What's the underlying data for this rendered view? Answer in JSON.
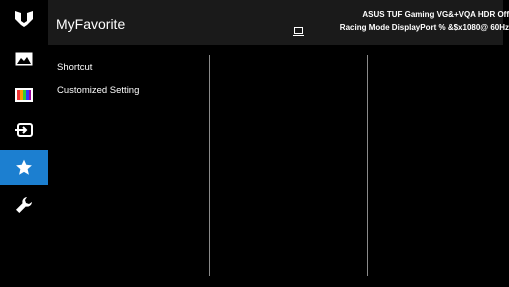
{
  "sidebar": {
    "icons": [
      {
        "name": "tuf-logo-icon"
      },
      {
        "name": "image-icon"
      },
      {
        "name": "color-icon"
      },
      {
        "name": "input-select-icon"
      },
      {
        "name": "star-icon"
      },
      {
        "name": "wrench-icon"
      }
    ],
    "active_index": 4,
    "active_color": "#1c7fd0"
  },
  "header": {
    "title": "MyFavorite",
    "status_line1": "ASUS TUF Gaming  VG&+VQA  HDR Off",
    "status_line2": "Racing Mode  DisplayPort  % &$x1080@ 60Hz"
  },
  "menu": {
    "items": [
      "Shortcut",
      "Customized Setting"
    ]
  }
}
